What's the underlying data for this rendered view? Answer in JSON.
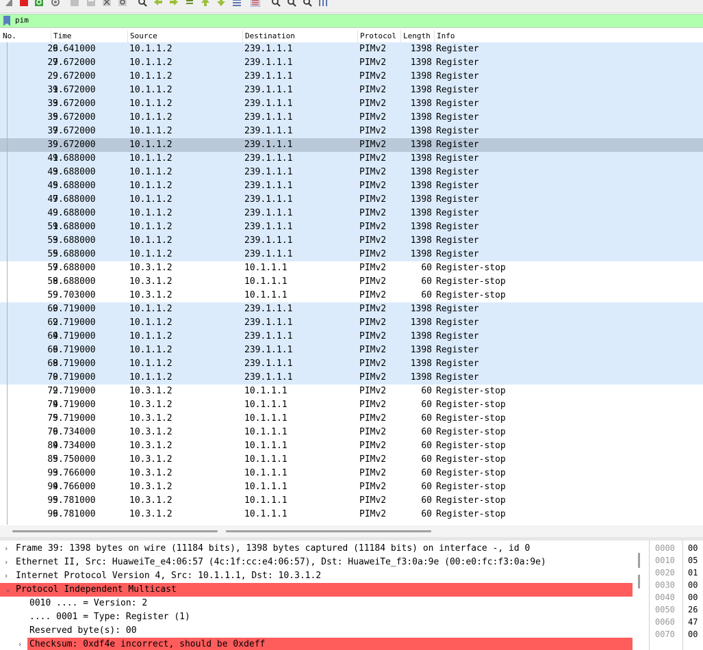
{
  "filter": {
    "text": "pim"
  },
  "columns": [
    "No.",
    "Time",
    "Source",
    "Destination",
    "Protocol",
    "Length",
    "Info"
  ],
  "packets": [
    {
      "no": "26",
      "time": "9.641000",
      "src": "10.1.1.2",
      "dst": "239.1.1.1",
      "proto": "PIMv2",
      "len": "1398",
      "info": "Register",
      "kind": "reg"
    },
    {
      "no": "27",
      "time": "9.672000",
      "src": "10.1.1.2",
      "dst": "239.1.1.1",
      "proto": "PIMv2",
      "len": "1398",
      "info": "Register",
      "kind": "reg"
    },
    {
      "no": "29",
      "time": "9.672000",
      "src": "10.1.1.2",
      "dst": "239.1.1.1",
      "proto": "PIMv2",
      "len": "1398",
      "info": "Register",
      "kind": "reg"
    },
    {
      "no": "31",
      "time": "9.672000",
      "src": "10.1.1.2",
      "dst": "239.1.1.1",
      "proto": "PIMv2",
      "len": "1398",
      "info": "Register",
      "kind": "reg"
    },
    {
      "no": "33",
      "time": "9.672000",
      "src": "10.1.1.2",
      "dst": "239.1.1.1",
      "proto": "PIMv2",
      "len": "1398",
      "info": "Register",
      "kind": "reg"
    },
    {
      "no": "35",
      "time": "9.672000",
      "src": "10.1.1.2",
      "dst": "239.1.1.1",
      "proto": "PIMv2",
      "len": "1398",
      "info": "Register",
      "kind": "reg"
    },
    {
      "no": "37",
      "time": "9.672000",
      "src": "10.1.1.2",
      "dst": "239.1.1.1",
      "proto": "PIMv2",
      "len": "1398",
      "info": "Register",
      "kind": "reg"
    },
    {
      "no": "39",
      "time": "9.672000",
      "src": "10.1.1.2",
      "dst": "239.1.1.1",
      "proto": "PIMv2",
      "len": "1398",
      "info": "Register",
      "kind": "sel"
    },
    {
      "no": "41",
      "time": "9.688000",
      "src": "10.1.1.2",
      "dst": "239.1.1.1",
      "proto": "PIMv2",
      "len": "1398",
      "info": "Register",
      "kind": "reg"
    },
    {
      "no": "43",
      "time": "9.688000",
      "src": "10.1.1.2",
      "dst": "239.1.1.1",
      "proto": "PIMv2",
      "len": "1398",
      "info": "Register",
      "kind": "reg"
    },
    {
      "no": "45",
      "time": "9.688000",
      "src": "10.1.1.2",
      "dst": "239.1.1.1",
      "proto": "PIMv2",
      "len": "1398",
      "info": "Register",
      "kind": "reg"
    },
    {
      "no": "47",
      "time": "9.688000",
      "src": "10.1.1.2",
      "dst": "239.1.1.1",
      "proto": "PIMv2",
      "len": "1398",
      "info": "Register",
      "kind": "reg"
    },
    {
      "no": "49",
      "time": "9.688000",
      "src": "10.1.1.2",
      "dst": "239.1.1.1",
      "proto": "PIMv2",
      "len": "1398",
      "info": "Register",
      "kind": "reg"
    },
    {
      "no": "51",
      "time": "9.688000",
      "src": "10.1.1.2",
      "dst": "239.1.1.1",
      "proto": "PIMv2",
      "len": "1398",
      "info": "Register",
      "kind": "reg"
    },
    {
      "no": "53",
      "time": "9.688000",
      "src": "10.1.1.2",
      "dst": "239.1.1.1",
      "proto": "PIMv2",
      "len": "1398",
      "info": "Register",
      "kind": "reg"
    },
    {
      "no": "55",
      "time": "9.688000",
      "src": "10.1.1.2",
      "dst": "239.1.1.1",
      "proto": "PIMv2",
      "len": "1398",
      "info": "Register",
      "kind": "reg"
    },
    {
      "no": "57",
      "time": "9.688000",
      "src": "10.3.1.2",
      "dst": "10.1.1.1",
      "proto": "PIMv2",
      "len": "60",
      "info": "Register-stop",
      "kind": "stop"
    },
    {
      "no": "58",
      "time": "9.688000",
      "src": "10.3.1.2",
      "dst": "10.1.1.1",
      "proto": "PIMv2",
      "len": "60",
      "info": "Register-stop",
      "kind": "stop"
    },
    {
      "no": "59",
      "time": "9.703000",
      "src": "10.3.1.2",
      "dst": "10.1.1.1",
      "proto": "PIMv2",
      "len": "60",
      "info": "Register-stop",
      "kind": "stop"
    },
    {
      "no": "60",
      "time": "9.719000",
      "src": "10.1.1.2",
      "dst": "239.1.1.1",
      "proto": "PIMv2",
      "len": "1398",
      "info": "Register",
      "kind": "reg"
    },
    {
      "no": "62",
      "time": "9.719000",
      "src": "10.1.1.2",
      "dst": "239.1.1.1",
      "proto": "PIMv2",
      "len": "1398",
      "info": "Register",
      "kind": "reg"
    },
    {
      "no": "64",
      "time": "9.719000",
      "src": "10.1.1.2",
      "dst": "239.1.1.1",
      "proto": "PIMv2",
      "len": "1398",
      "info": "Register",
      "kind": "reg"
    },
    {
      "no": "66",
      "time": "9.719000",
      "src": "10.1.1.2",
      "dst": "239.1.1.1",
      "proto": "PIMv2",
      "len": "1398",
      "info": "Register",
      "kind": "reg"
    },
    {
      "no": "68",
      "time": "9.719000",
      "src": "10.1.1.2",
      "dst": "239.1.1.1",
      "proto": "PIMv2",
      "len": "1398",
      "info": "Register",
      "kind": "reg"
    },
    {
      "no": "70",
      "time": "9.719000",
      "src": "10.1.1.2",
      "dst": "239.1.1.1",
      "proto": "PIMv2",
      "len": "1398",
      "info": "Register",
      "kind": "reg"
    },
    {
      "no": "72",
      "time": "9.719000",
      "src": "10.3.1.2",
      "dst": "10.1.1.1",
      "proto": "PIMv2",
      "len": "60",
      "info": "Register-stop",
      "kind": "stop"
    },
    {
      "no": "74",
      "time": "9.719000",
      "src": "10.3.1.2",
      "dst": "10.1.1.1",
      "proto": "PIMv2",
      "len": "60",
      "info": "Register-stop",
      "kind": "stop"
    },
    {
      "no": "75",
      "time": "9.719000",
      "src": "10.3.1.2",
      "dst": "10.1.1.1",
      "proto": "PIMv2",
      "len": "60",
      "info": "Register-stop",
      "kind": "stop"
    },
    {
      "no": "76",
      "time": "9.734000",
      "src": "10.3.1.2",
      "dst": "10.1.1.1",
      "proto": "PIMv2",
      "len": "60",
      "info": "Register-stop",
      "kind": "stop"
    },
    {
      "no": "84",
      "time": "9.734000",
      "src": "10.3.1.2",
      "dst": "10.1.1.1",
      "proto": "PIMv2",
      "len": "60",
      "info": "Register-stop",
      "kind": "stop"
    },
    {
      "no": "85",
      "time": "9.750000",
      "src": "10.3.1.2",
      "dst": "10.1.1.1",
      "proto": "PIMv2",
      "len": "60",
      "info": "Register-stop",
      "kind": "stop"
    },
    {
      "no": "93",
      "time": "9.766000",
      "src": "10.3.1.2",
      "dst": "10.1.1.1",
      "proto": "PIMv2",
      "len": "60",
      "info": "Register-stop",
      "kind": "stop"
    },
    {
      "no": "94",
      "time": "9.766000",
      "src": "10.3.1.2",
      "dst": "10.1.1.1",
      "proto": "PIMv2",
      "len": "60",
      "info": "Register-stop",
      "kind": "stop"
    },
    {
      "no": "95",
      "time": "9.781000",
      "src": "10.3.1.2",
      "dst": "10.1.1.1",
      "proto": "PIMv2",
      "len": "60",
      "info": "Register-stop",
      "kind": "stop"
    },
    {
      "no": "96",
      "time": "9.781000",
      "src": "10.3.1.2",
      "dst": "10.1.1.1",
      "proto": "PIMv2",
      "len": "60",
      "info": "Register-stop",
      "kind": "stop"
    }
  ],
  "details": [
    {
      "text": "Frame 39: 1398 bytes on wire (11184 bits), 1398 bytes captured (11184 bits) on interface -, id 0",
      "expanded": false,
      "level": 0,
      "highlight": false
    },
    {
      "text": "Ethernet II, Src: HuaweiTe_e4:06:57 (4c:1f:cc:e4:06:57), Dst: HuaweiTe_f3:0a:9e (00:e0:fc:f3:0a:9e)",
      "expanded": false,
      "level": 0,
      "highlight": false
    },
    {
      "text": "Internet Protocol Version 4, Src: 10.1.1.1, Dst: 10.3.1.2",
      "expanded": false,
      "level": 0,
      "highlight": false
    },
    {
      "text": "Protocol Independent Multicast",
      "expanded": true,
      "level": 0,
      "highlight": true
    },
    {
      "text": "0010 .... = Version: 2",
      "expanded": null,
      "level": 1,
      "highlight": false
    },
    {
      "text": ".... 0001 = Type: Register (1)",
      "expanded": null,
      "level": 1,
      "highlight": false
    },
    {
      "text": "Reserved byte(s): 00",
      "expanded": null,
      "level": 1,
      "highlight": false
    },
    {
      "text": "Checksum: 0xdf4e incorrect, should be 0xdeff",
      "expanded": false,
      "level": 2,
      "highlight": true
    }
  ],
  "hex": [
    {
      "off": "0000",
      "val": "00"
    },
    {
      "off": "0010",
      "val": "05"
    },
    {
      "off": "0020",
      "val": "01"
    },
    {
      "off": "0030",
      "val": "00"
    },
    {
      "off": "0040",
      "val": "00"
    },
    {
      "off": "0050",
      "val": "26"
    },
    {
      "off": "0060",
      "val": "47"
    },
    {
      "off": "0070",
      "val": "00"
    }
  ],
  "colors": {
    "filter_ok": "#afffaf",
    "register_row": "#dbebfb",
    "selected_row": "#b9c9d9",
    "error_highlight": "#ff5c5c"
  },
  "icons": [
    "shark-fin-icon",
    "stop-capture-icon",
    "restart-capture-icon",
    "capture-options-icon",
    "open-file-icon",
    "save-file-icon",
    "close-file-icon",
    "reload-icon",
    "find-icon",
    "go-back-icon",
    "go-forward-icon",
    "go-to-packet-icon",
    "go-first-icon",
    "go-last-icon",
    "auto-scroll-icon",
    "colorize-icon",
    "zoom-in-icon",
    "zoom-out-icon",
    "zoom-normal-icon",
    "resize-columns-icon"
  ]
}
